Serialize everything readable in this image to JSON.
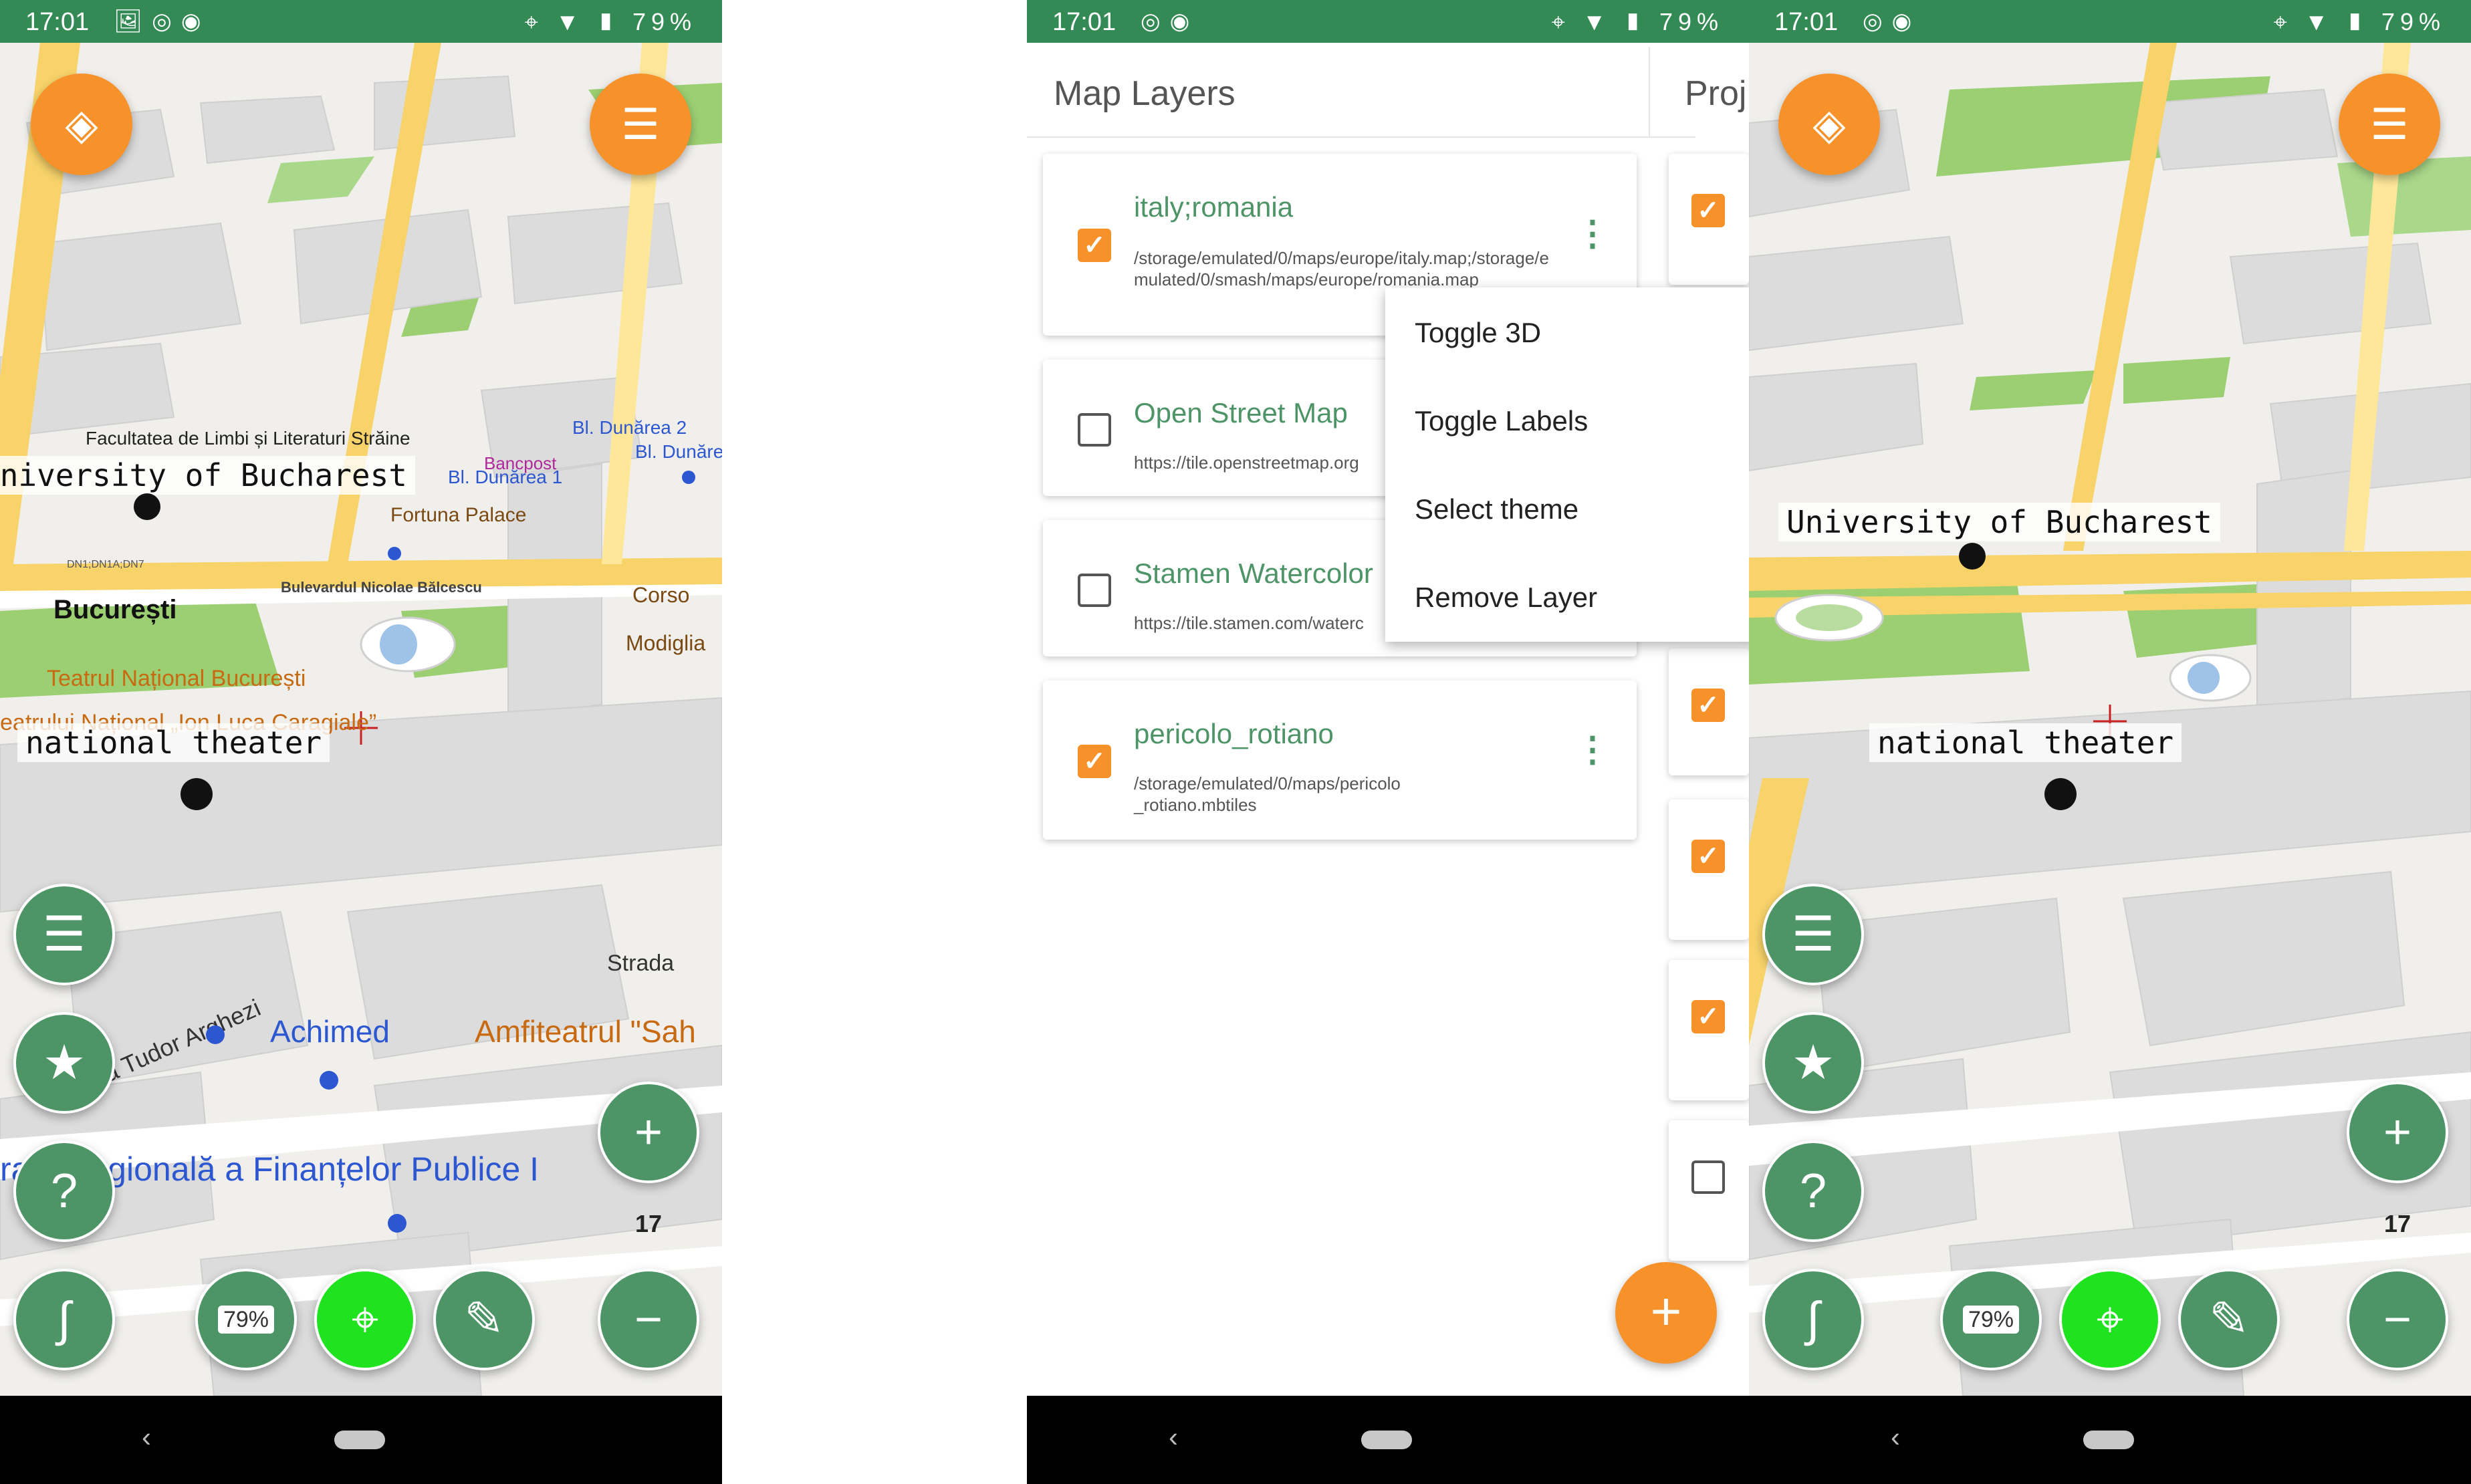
{
  "status": {
    "time": "17:01",
    "battery": "79%",
    "icons_left": [
      "image-icon",
      "hotspot-icon",
      "nfc-icon"
    ],
    "icons_right": [
      "location-icon",
      "wifi-icon",
      "signal-icon",
      "battery-icon"
    ]
  },
  "map_left": {
    "labels": {
      "university": "University of Bucharest",
      "theater": "national theater",
      "faculty": "Facultatea de Limbi și Literaturi Străine",
      "bucuresti": "București",
      "teatrul": "Teatrul Național București",
      "teatrul2": "eatrului Național „Ion Luca Caragiale”",
      "fortuna": "Fortuna Palace",
      "dunarea2": "Bl. Dunărea 2",
      "dunarea1": "Bl. Dunărea 1",
      "dunare": "Bl. Dunăre",
      "bancpost": "Bancpost",
      "corso": "Corso",
      "modiglia": "Modiglia",
      "bulevardul": "Bulevardul Nicolae Bălcescu",
      "strada": "Strada",
      "tudor": "Strada Tudor Arghezi",
      "achimed": "Achimed",
      "amfiteatrul": "Amfiteatrul \"Sah",
      "regionala": "rală Regională a Finanțelor Publice I",
      "dn": "DN1;DN1A;DN7"
    },
    "zoom": "17",
    "battery_badge": "79%"
  },
  "layers": {
    "title": "Map Layers",
    "projects_tab": "Proj",
    "items": [
      {
        "name": "italy;romania",
        "path": "/storage/emulated/0/maps/europe/italy.map;/storage/emulated/0/smash/maps/europe/romania.map",
        "checked": true
      },
      {
        "name": "Open Street Map",
        "path": "https://tile.openstreetmap.org",
        "checked": false
      },
      {
        "name": "Stamen Watercolor",
        "path": "https://tile.stamen.com/waterc",
        "checked": false
      },
      {
        "name": "pericolo_rotiano",
        "path": "/storage/emulated/0/maps/pericolo_rotiano.mbtiles",
        "checked": true
      }
    ],
    "menu": [
      "Toggle 3D",
      "Toggle Labels",
      "Select theme",
      "Remove Layer"
    ],
    "add_button": "+"
  },
  "map_right": {
    "labels": {
      "university": "University of Bucharest",
      "theater": "national theater"
    },
    "zoom": "17",
    "battery_badge": "79%"
  },
  "colors": {
    "status_bar": "#338a54",
    "orange": "#f7922b",
    "green_button": "#4d9467",
    "bright_green": "#1ee31e"
  }
}
